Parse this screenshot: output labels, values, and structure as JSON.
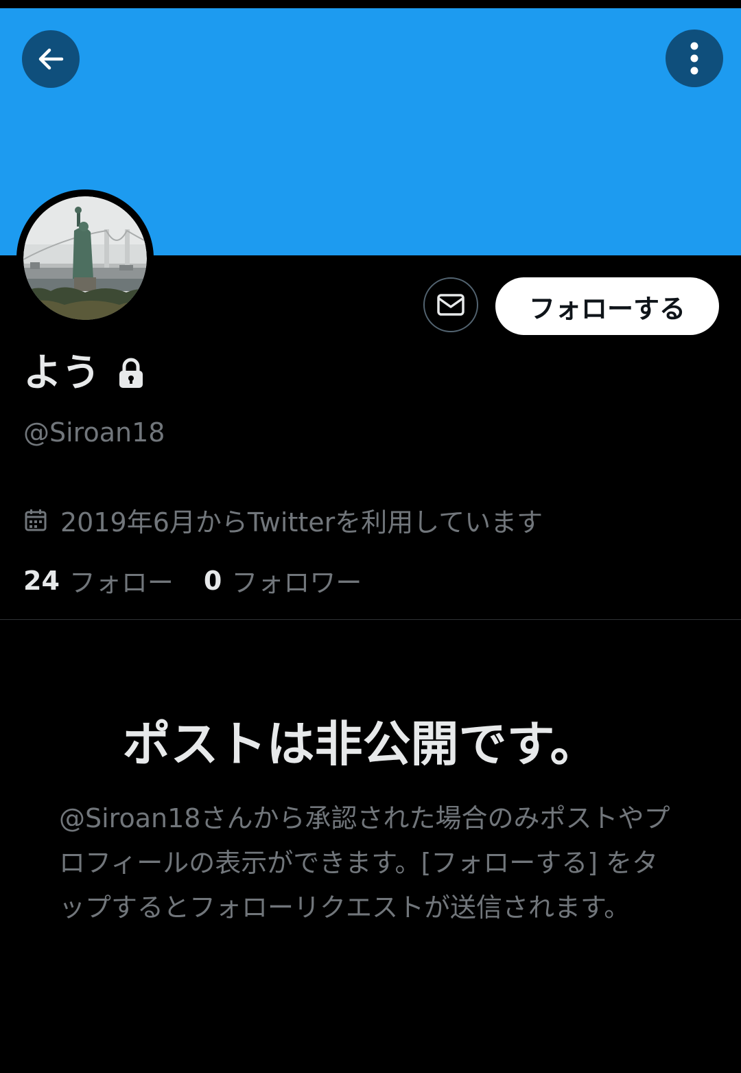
{
  "header": {
    "back_icon": "arrow-left-icon",
    "more_icon": "more-vertical-icon",
    "banner_color": "#1d9bf0"
  },
  "profile": {
    "avatar_description": "Statue of Liberty replica with Rainbow Bridge",
    "display_name": "よう",
    "protected_icon": "lock-icon",
    "handle": "@Siroan18",
    "joined": "2019年6月からTwitterを利用しています",
    "following_count": "24",
    "following_label": "フォロー",
    "followers_count": "0",
    "followers_label": "フォロワー"
  },
  "actions": {
    "message_icon": "envelope-icon",
    "follow_label": "フォローする"
  },
  "protected_notice": {
    "title": "ポストは非公開です。",
    "body": "@Siroan18さんから承認された場合のみポストやプロフィールの表示ができます。[フォローする] をタップするとフォローリクエストが送信されます。"
  },
  "colors": {
    "accent": "#1d9bf0",
    "background": "#000000",
    "text_primary": "#e7e9ea",
    "text_secondary": "#71767b"
  }
}
